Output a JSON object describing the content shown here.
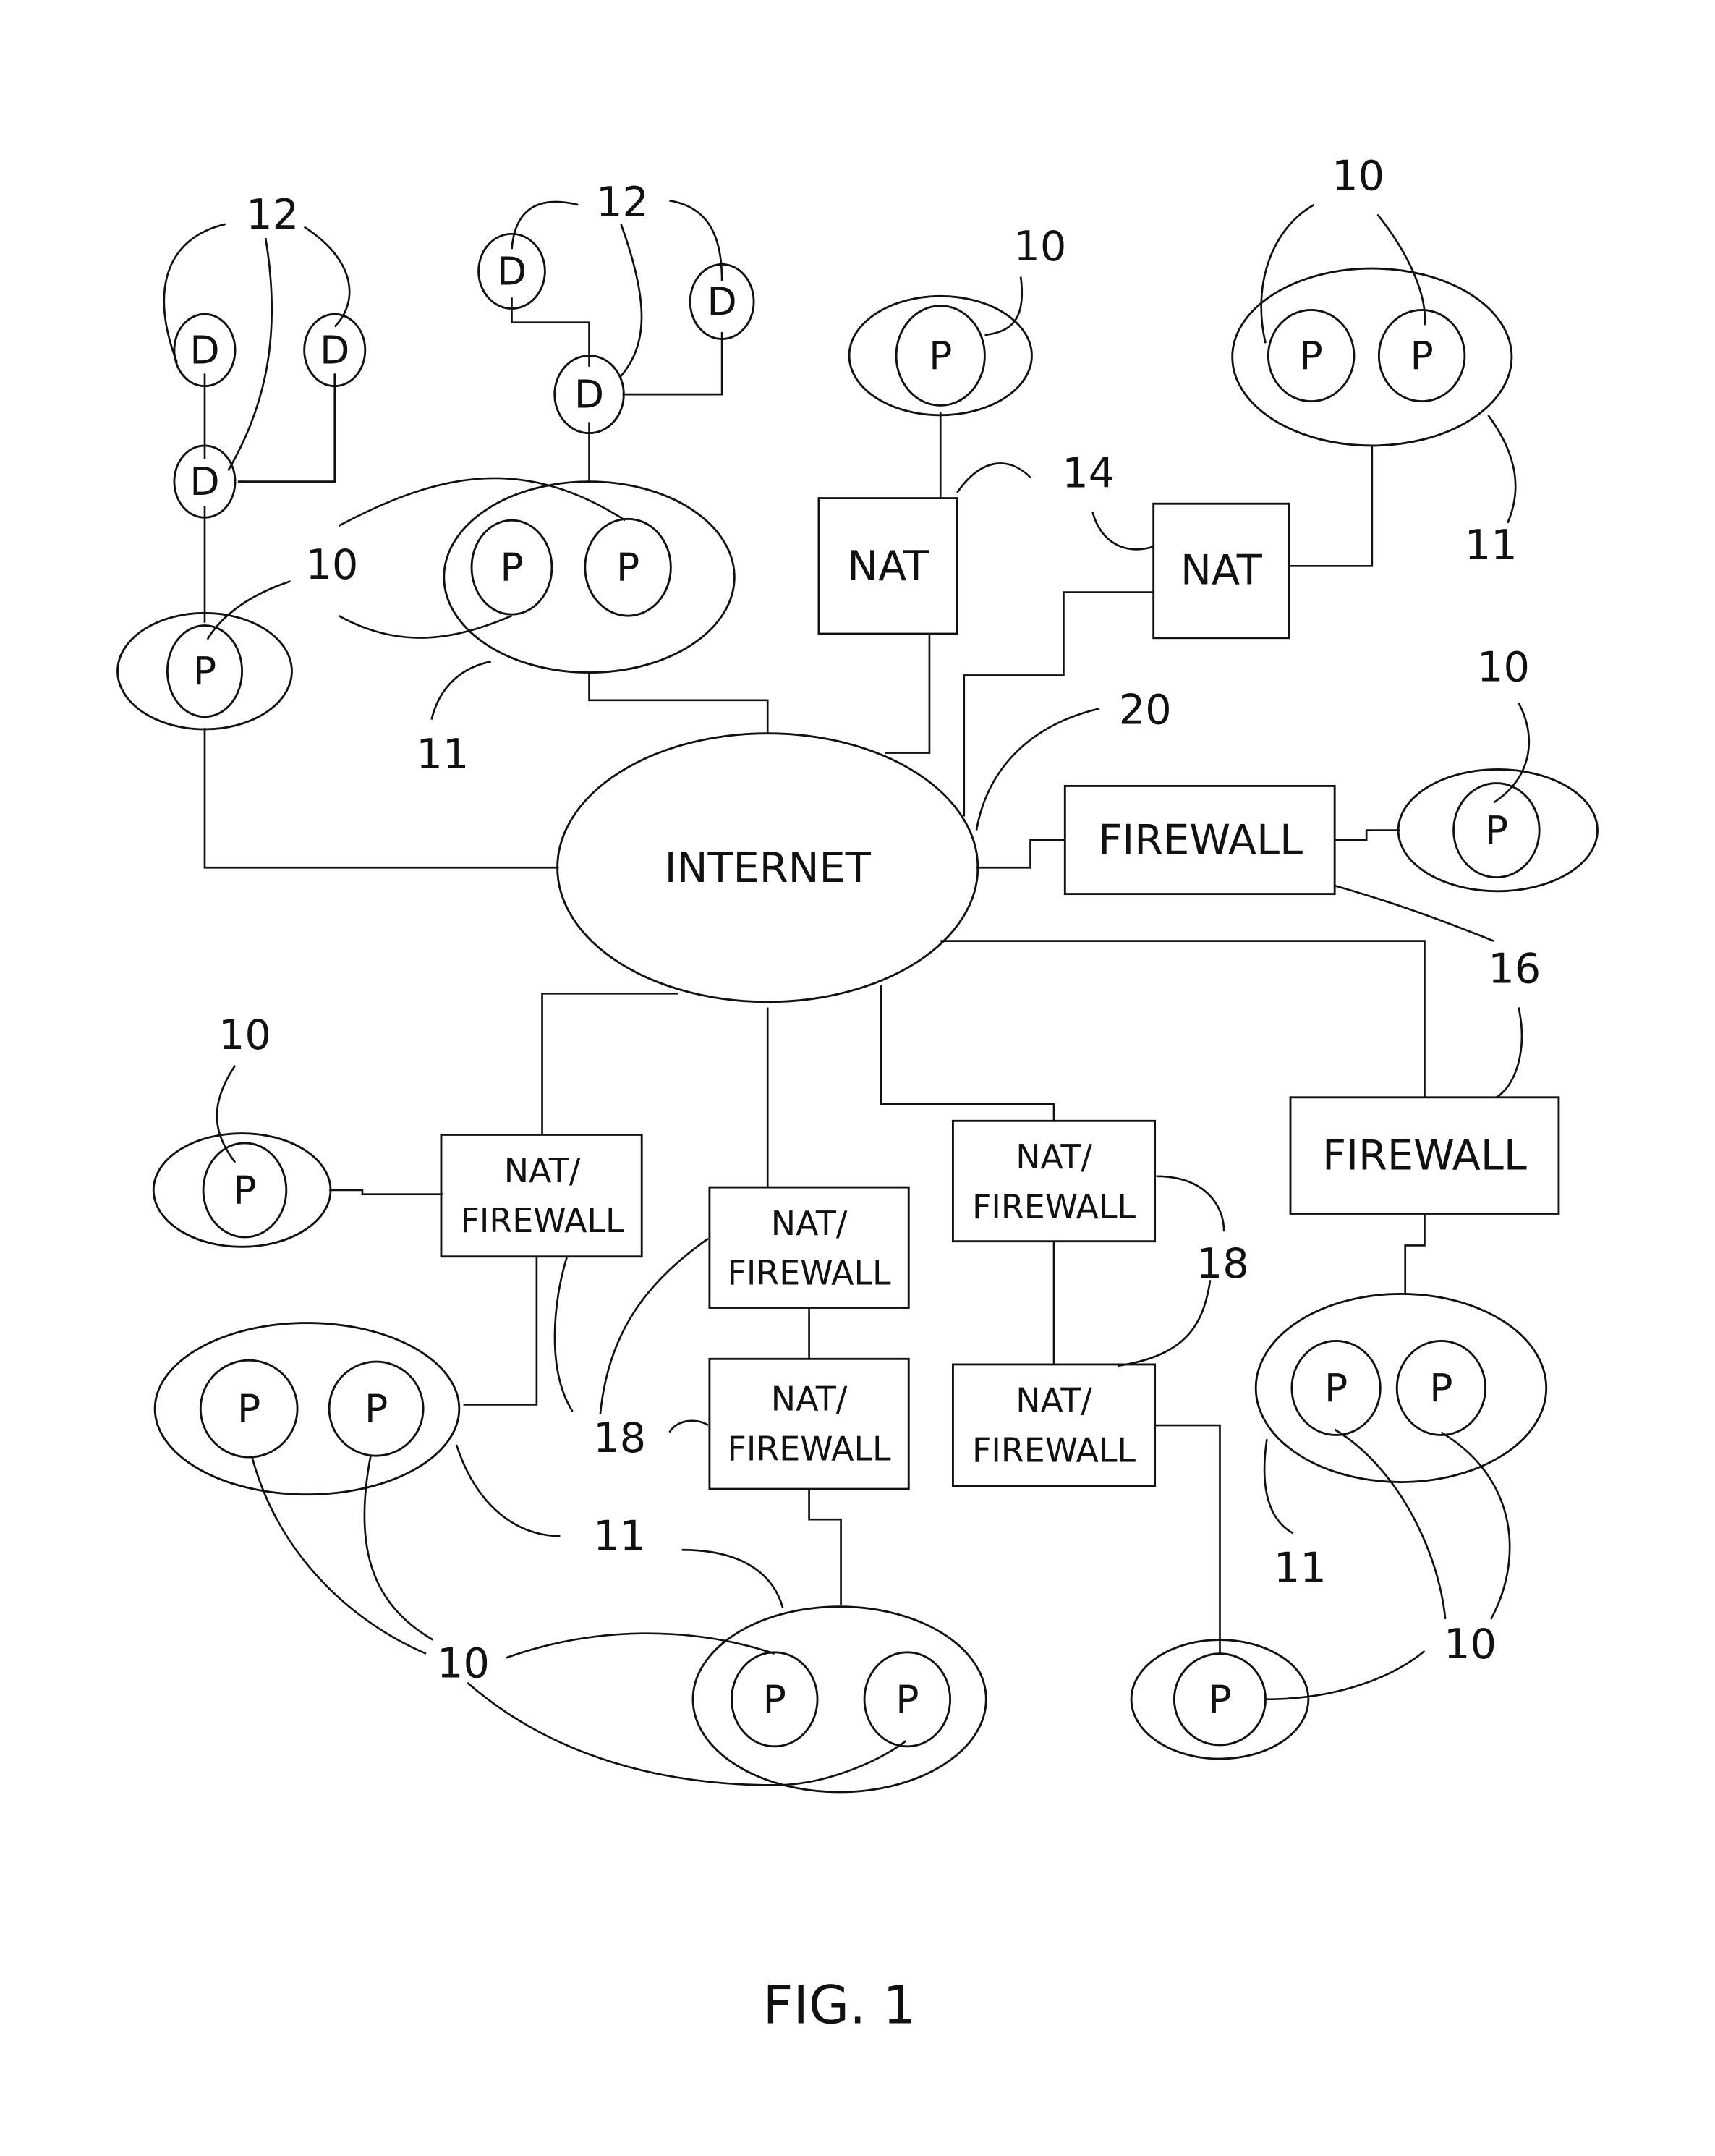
{
  "figure": {
    "caption": "FIG. 1",
    "center_node": "INTERNET"
  },
  "node_labels": {
    "peer": "P",
    "device": "D",
    "nat": "NAT",
    "firewall": "FIREWALL",
    "natfw_line1": "NAT/",
    "natfw_line2": "FIREWALL"
  },
  "reference_numerals": {
    "peer": "10",
    "group": "11",
    "device": "12",
    "nat": "14",
    "firewall": "16",
    "nat_firewall": "18",
    "internet": "20"
  }
}
